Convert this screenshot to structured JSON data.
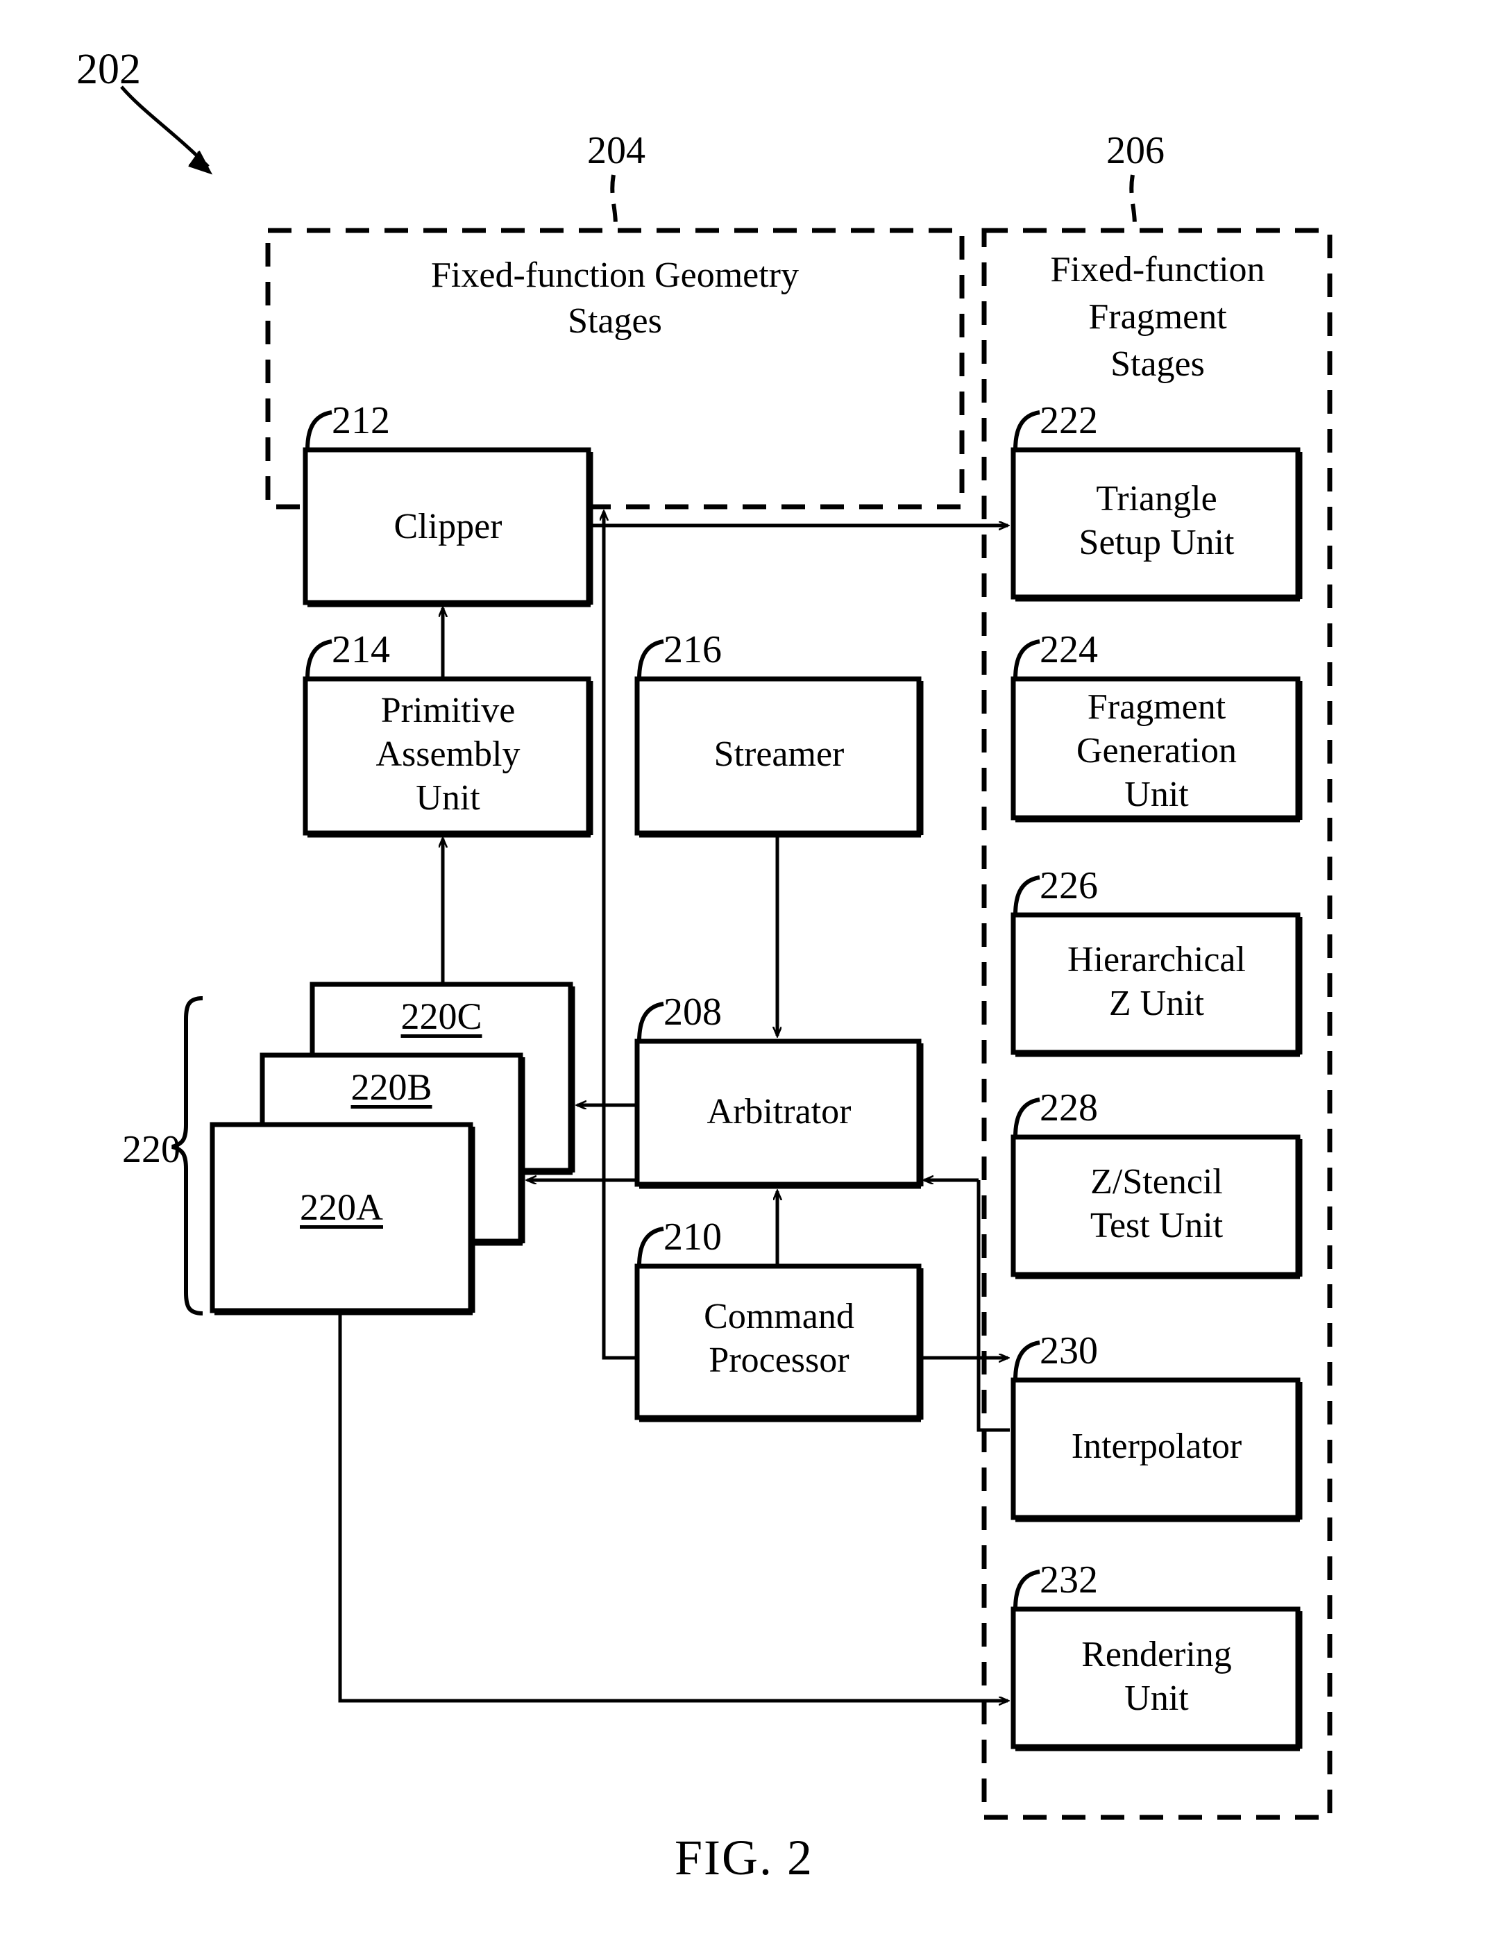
{
  "figure": {
    "caption": "FIG.  2",
    "top_ref": "202"
  },
  "groups": [
    {
      "id": "geometry",
      "ref": "204",
      "title_line1": "Fixed-function Geometry",
      "title_line2": "Stages"
    },
    {
      "id": "fragment",
      "ref": "206",
      "title_line1": "Fixed-function",
      "title_line2": "Fragment",
      "title_line3": "Stages"
    }
  ],
  "blocks": {
    "clipper": {
      "ref": "212",
      "label": "Clipper"
    },
    "primitive_assembly": {
      "ref": "214",
      "label_line1": "Primitive",
      "label_line2": "Assembly",
      "label_line3": "Unit"
    },
    "streamer": {
      "ref": "216",
      "label": "Streamer"
    },
    "arbitrator": {
      "ref": "208",
      "label": "Arbitrator"
    },
    "command_processor": {
      "ref": "210",
      "label_line1": "Command",
      "label_line2": "Processor"
    },
    "triangle_setup": {
      "ref": "222",
      "label_line1": "Triangle",
      "label_line2": "Setup Unit"
    },
    "fragment_generation": {
      "ref": "224",
      "label_line1": "Fragment",
      "label_line2": "Generation",
      "label_line3": "Unit"
    },
    "hierarchical_z": {
      "ref": "226",
      "label_line1": "Hierarchical",
      "label_line2": "Z Unit"
    },
    "z_stencil_test": {
      "ref": "228",
      "label_line1": "Z/Stencil",
      "label_line2": "Test Unit"
    },
    "interpolator": {
      "ref": "230",
      "label": "Interpolator"
    },
    "rendering_unit": {
      "ref": "232",
      "label_line1": "Rendering",
      "label_line2": "Unit"
    }
  },
  "shader_stack": {
    "group_ref": "220",
    "items": [
      {
        "label": "220C"
      },
      {
        "label": "220B"
      },
      {
        "label": "220A"
      }
    ]
  },
  "colors": {
    "ink": "#000000",
    "paper": "#ffffff"
  }
}
